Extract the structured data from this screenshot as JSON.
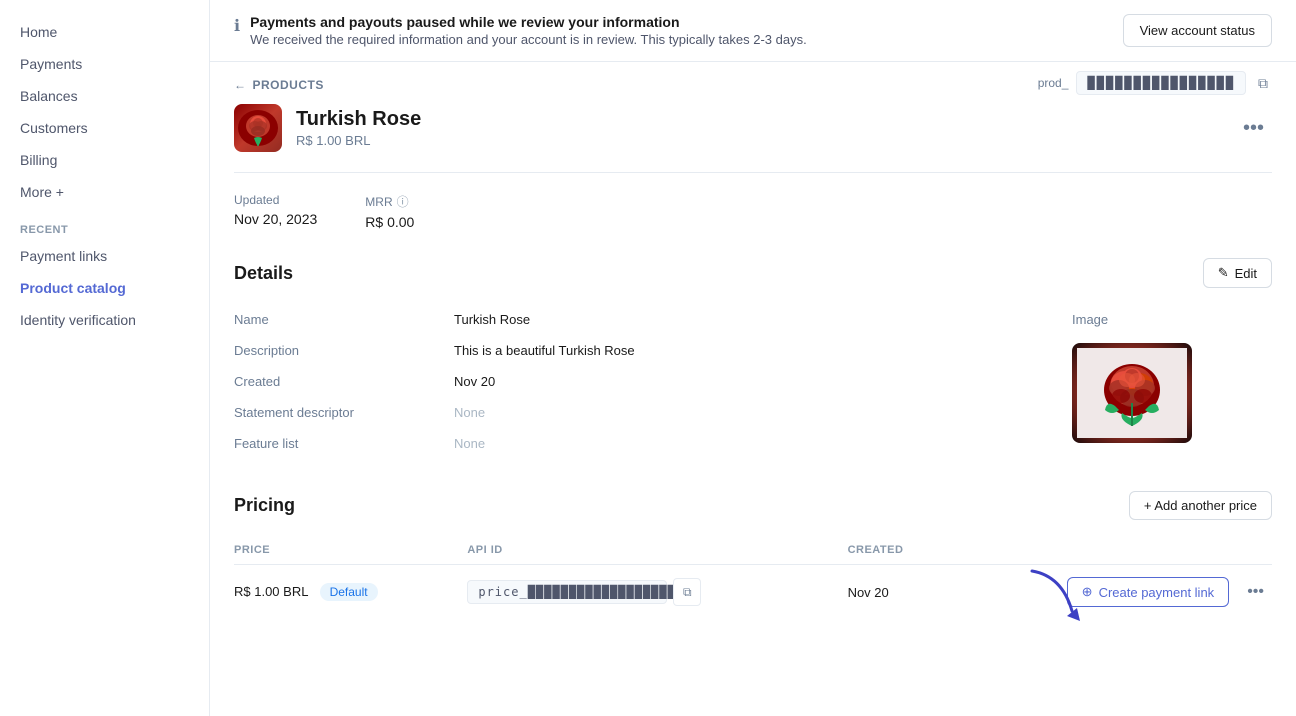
{
  "sidebar": {
    "nav": [
      {
        "id": "home",
        "label": "Home"
      },
      {
        "id": "payments",
        "label": "Payments"
      },
      {
        "id": "balances",
        "label": "Balances"
      },
      {
        "id": "customers",
        "label": "Customers"
      },
      {
        "id": "billing",
        "label": "Billing"
      },
      {
        "id": "more",
        "label": "More +"
      }
    ],
    "recent_label": "Recent",
    "recent_items": [
      {
        "id": "payment-links",
        "label": "Payment links"
      },
      {
        "id": "product-catalog",
        "label": "Product catalog",
        "active": true
      },
      {
        "id": "identity-verification",
        "label": "Identity verification"
      }
    ]
  },
  "banner": {
    "icon": "ℹ",
    "title": "Payments and payouts paused while we review your information",
    "subtitle": "We received the required information and your account is in review. This typically takes 2-3 days.",
    "button_label": "View account status"
  },
  "breadcrumb": {
    "arrow": "←",
    "label": "PRODUCTS"
  },
  "product": {
    "id_prefix": "prod_",
    "id_masked": "████████████████",
    "name": "Turkish Rose",
    "price": "R$ 1.00 BRL"
  },
  "stats": {
    "updated_label": "Updated",
    "updated_value": "Nov 20, 2023",
    "mrr_label": "MRR",
    "mrr_value": "R$ 0.00"
  },
  "details": {
    "section_title": "Details",
    "edit_label": "Edit",
    "rows": [
      {
        "label": "Name",
        "value": "Turkish Rose",
        "muted": false
      },
      {
        "label": "Description",
        "value": "This is a beautiful Turkish Rose",
        "muted": false
      },
      {
        "label": "Created",
        "value": "Nov 20",
        "muted": false
      },
      {
        "label": "Statement descriptor",
        "value": "None",
        "muted": true
      },
      {
        "label": "Feature list",
        "value": "None",
        "muted": true
      }
    ],
    "image_label": "Image"
  },
  "pricing": {
    "section_title": "Pricing",
    "add_price_label": "+ Add another price",
    "columns": [
      "PRICE",
      "API ID",
      "CREATED"
    ],
    "rows": [
      {
        "price": "R$ 1.00 BRL",
        "badge": "Default",
        "api_id_prefix": "price_",
        "api_id_masked": "████████████████████",
        "created": "Nov 20",
        "create_payment_label": "Create payment link"
      }
    ]
  },
  "icons": {
    "pencil": "✎",
    "copy": "⧉",
    "info": "ⓘ",
    "plus": "+",
    "link": "⊕",
    "dots": "•••"
  }
}
